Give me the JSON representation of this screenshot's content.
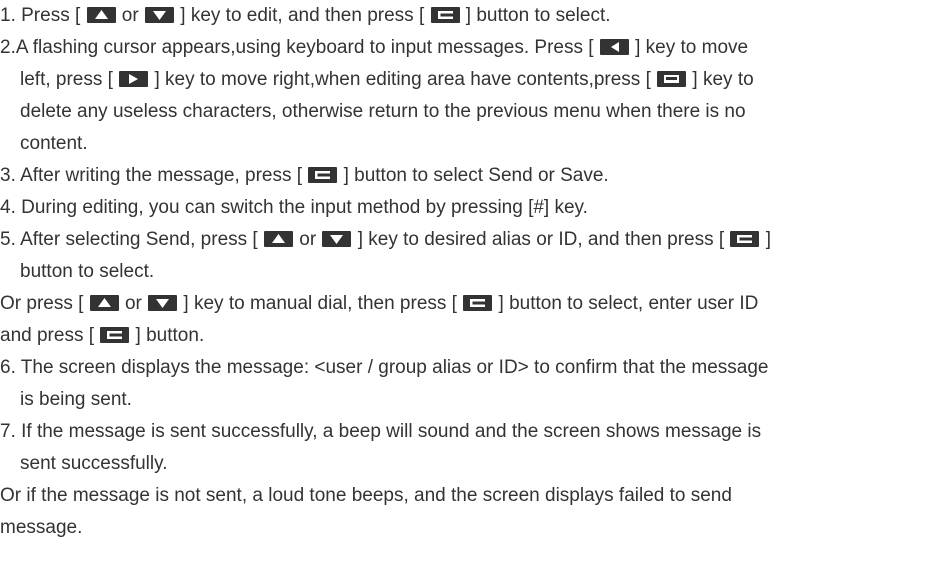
{
  "icons": {
    "up": "triangle-up-key-icon",
    "down": "triangle-down-key-icon",
    "left": "triangle-left-key-icon",
    "right": "triangle-right-key-icon",
    "menu": "menu-key-icon",
    "delete": "delete-key-icon"
  },
  "key_color": "#333333",
  "text_color": "#333333",
  "steps": {
    "s1": {
      "a": "1. Press [ ",
      "or": " or ",
      "b": " ] key to edit, and then press [ ",
      "c": " ] button to select."
    },
    "s2": {
      "a": "2.A flashing cursor appears,using keyboard to input messages. Press [ ",
      "b": " ] key to move",
      "c": "left, press [ ",
      "d": " ] key to move right,when editing area have contents,press [ ",
      "e": " ] key to",
      "f": "delete any useless characters, otherwise return to the previous menu when there is no",
      "g": "content."
    },
    "s3": {
      "a": "3. After writing the message, press [ ",
      "b": " ] button to select Send or Save."
    },
    "s4": "4. During editing, you can switch the input method by pressing [#] key.",
    "s5": {
      "a": "5. After selecting Send, press [ ",
      "or": " or ",
      "b": " ] key to desired alias or ID, and then press [ ",
      "c": " ]",
      "d": "button to select."
    },
    "alt5": {
      "a": "Or press [ ",
      "or": " or ",
      "b": " ] key to manual dial, then press  [ ",
      "c": " ] button to select, enter user ID",
      "d": "and press [ ",
      "e": " ] button."
    },
    "s6": {
      "a": "6. The screen displays the message: <user / group alias or ID> to confirm that the message",
      "b": "is being sent."
    },
    "s7": {
      "a": "7. If the message is sent successfully, a beep will sound and the screen shows message is",
      "b": "sent successfully."
    },
    "alt7": {
      "a": "Or if the message is not sent, a loud tone beeps, and the screen displays failed to send",
      "b": "message."
    }
  }
}
